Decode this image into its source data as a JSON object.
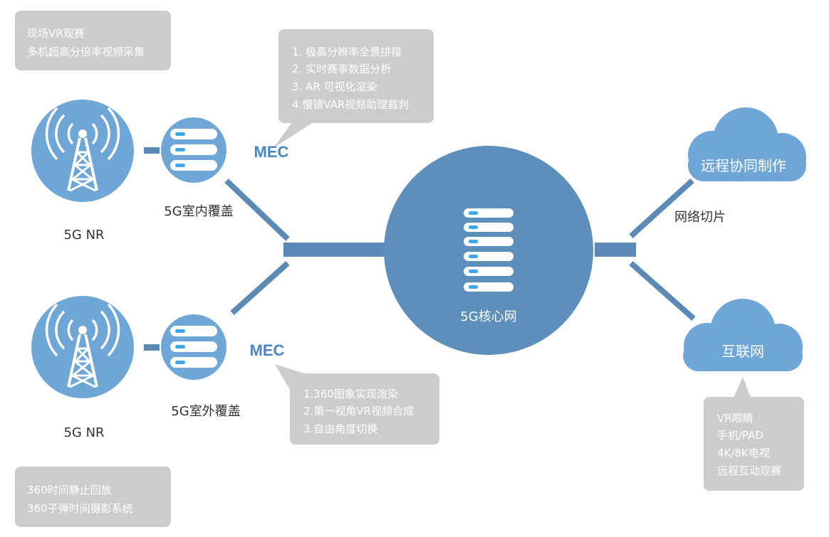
{
  "colors": {
    "node_blue": "#6fa6d8",
    "core_blue": "#5d8fbd",
    "connector": "#5a8ab5",
    "callout_gray": "#cccccc",
    "server_bar": "#ffffff",
    "server_led": "#3aa7f0",
    "mec_text": "#4a86c5"
  },
  "top_left_callout": {
    "line1": "现场VR观赛",
    "line2": "多机超高分倍率视频采集"
  },
  "bottom_left_callout": {
    "line1": "360时间静止回放",
    "line2": "360子弹时间摄影系统"
  },
  "mec_top_callout": {
    "line1": "1. 极高分辨率全景拼接",
    "line2": "2. 实时赛事数据分析",
    "line3": "3. AR 可视化渲染",
    "line4": "4.慢镜VAR视频助理裁判"
  },
  "mec_bottom_callout": {
    "line1": "1.360图象实现渲染",
    "line2": "2.第一视角VR视频合成",
    "line3": "3.自由角度切换"
  },
  "internet_callout": {
    "line1": "VR眼睛",
    "line2": "手机/PAD",
    "line3": "4K/8K电视",
    "line4": "远程互动观赛"
  },
  "labels": {
    "nr_top": "5G NR",
    "nr_bottom": "5G NR",
    "indoor": "5G室内覆盖",
    "outdoor": "5G室外覆盖",
    "mec_top": "MEC",
    "mec_bottom": "MEC",
    "core": "5G核心网",
    "slicing": "网络切片",
    "cloud_top": "远程协同制作",
    "cloud_bottom": "互联网"
  },
  "icons": {
    "antenna": "radio-tower-icon",
    "server": "server-rack-icon",
    "cloud": "cloud-icon"
  }
}
